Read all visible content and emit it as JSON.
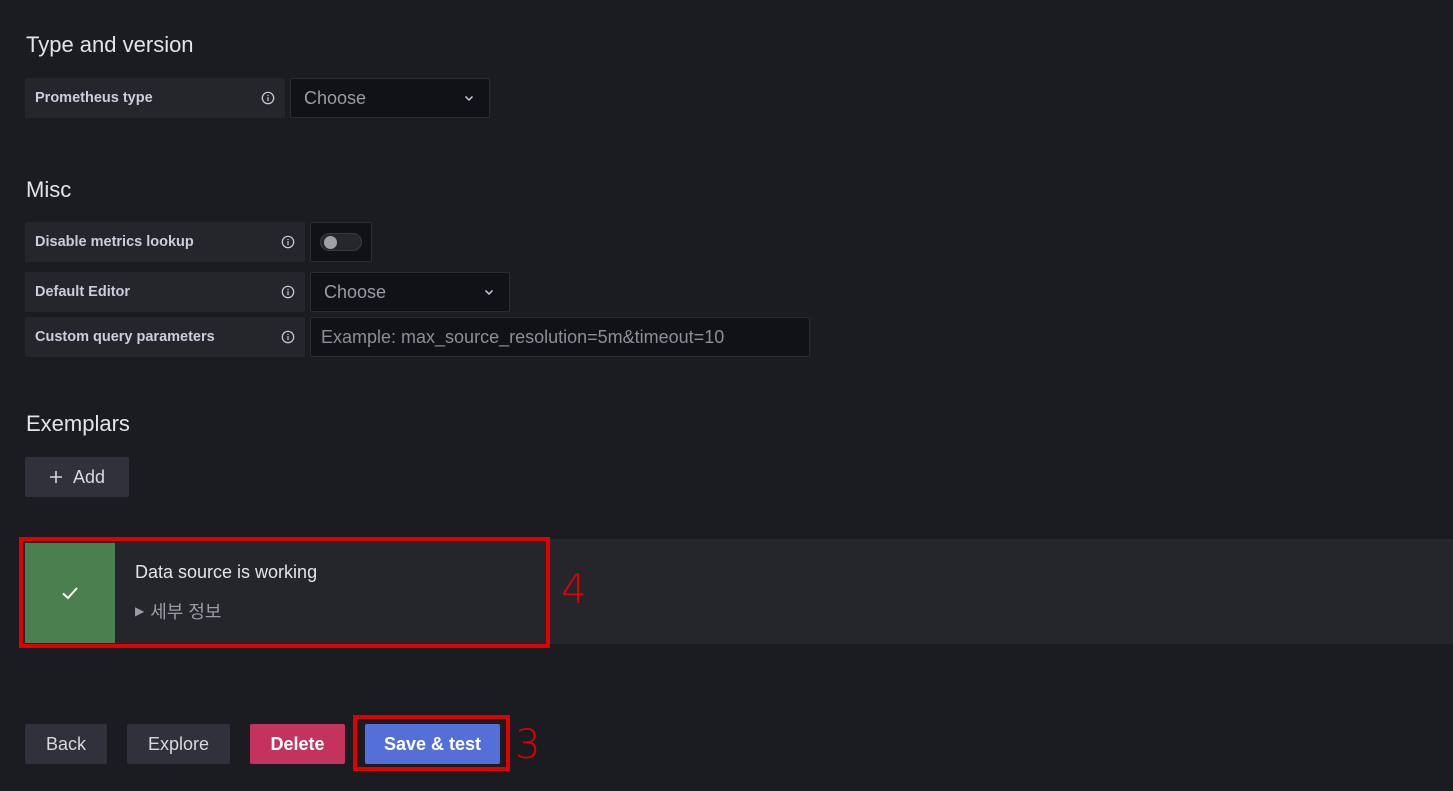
{
  "type_version": {
    "title": "Type and version",
    "prometheus_type": {
      "label": "Prometheus type",
      "value": "Choose"
    }
  },
  "misc": {
    "title": "Misc",
    "disable_metrics": {
      "label": "Disable metrics lookup",
      "enabled": false
    },
    "default_editor": {
      "label": "Default Editor",
      "value": "Choose"
    },
    "custom_query": {
      "label": "Custom query parameters",
      "placeholder": "Example: max_source_resolution=5m&timeout=10"
    }
  },
  "exemplars": {
    "title": "Exemplars",
    "add_label": "Add"
  },
  "alert": {
    "title": "Data source is working",
    "details_label": "세부 정보",
    "status_color": "#4a7f50"
  },
  "buttons": {
    "back": "Back",
    "explore": "Explore",
    "delete": "Delete",
    "save_test": "Save & test"
  },
  "annotations": {
    "alert_number": "4",
    "save_number": "3",
    "color": "#e00000"
  }
}
